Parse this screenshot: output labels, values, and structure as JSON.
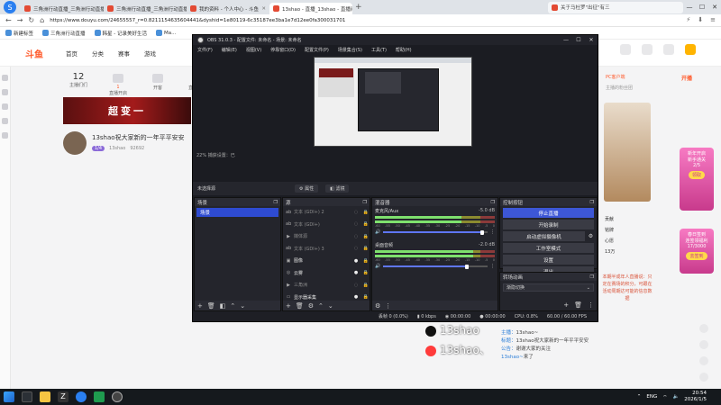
{
  "browser": {
    "tabs": [
      {
        "label": "三角洲行动直播_三角洲行动直播间",
        "active": false
      },
      {
        "label": "三角洲行动直播_三角洲行动直播间",
        "active": false
      },
      {
        "label": "我的资料 - 个人中心 - 斗鱼",
        "active": false
      },
      {
        "label": "13shao - 直播_13shao - 直播间",
        "active": true
      }
    ],
    "right_tab_label": "关于马杜罗\"出征\"有三",
    "url": "https://www.douyu.com/24655557_r=0.8211154635604441&dyshid=1e80119-6c35187ee3ba1e7d12ee0fa300031701",
    "bookmarks": [
      "新建标签",
      "三角洲行动直播",
      "韩星 - 记录美好生活",
      "Ma..."
    ]
  },
  "douyu": {
    "logo": "斗鱼",
    "nav": [
      "首页",
      "分类",
      "赛事",
      "游戏"
    ],
    "quick": [
      {
        "num": "12",
        "label": "主播们们",
        "badge": ""
      },
      {
        "num": "",
        "label": "直播开启",
        "badge": "1"
      },
      {
        "num": "",
        "label": "开客",
        "badge": ""
      },
      {
        "num": "",
        "label": "直播求车",
        "badge": ""
      }
    ],
    "banner_text": "超变一",
    "anchor": {
      "title": "13shao祝大家新的一年平平安安",
      "level": "1/4",
      "name": "13shao",
      "fans": "92692"
    },
    "right": {
      "top": "PC客户端",
      "sub": "主播的粉丝团",
      "items": [
        "贡献",
        "铭牌",
        "",
        "心愿",
        "13万"
      ],
      "vertical": "本期半成年人直播说：只定在赛场的积分，可跟在活动周期达可能的信息数据"
    },
    "promo": {
      "top": "开播",
      "cards": [
        {
          "title": "新年开启",
          "sub": "新手通关",
          "progress": "2/5",
          "btn": "领取"
        },
        {
          "title": "春日签到",
          "sub": "连签领福利",
          "progress": "17/3000",
          "btn": "去签到"
        }
      ]
    },
    "chat": [
      {
        "name": "主播：",
        "text": "13shao~"
      },
      {
        "name": "标题：",
        "text": "13shao祝大家新的一年平平安安"
      },
      {
        "name": "公告：",
        "text": "谢谢大家的关注"
      },
      {
        "name": "13shao~",
        "text": "来了"
      }
    ],
    "overlay": {
      "tiktok": "13shao",
      "weibo": "13shao、"
    }
  },
  "obs": {
    "title": "OBS 31.0.3 - 配置文件: 未命名 - 场景: 未命名",
    "menu": [
      "文件(F)",
      "编辑(E)",
      "视图(V)",
      "停靠窗口(D)",
      "配置文件(P)",
      "场景集合(S)",
      "工具(T)",
      "帮助(H)"
    ],
    "preview_status": "22%   捕获设置：已",
    "toolbar": {
      "no_source": "未选择源",
      "properties": "属性",
      "filters": "滤镜"
    },
    "docks": {
      "scenes": "场景",
      "sources": "源",
      "mixer": "混音器",
      "controls": "控制按钮",
      "transitions": "转场动画"
    },
    "scenes": [
      "场景"
    ],
    "sources": [
      {
        "label": "文本 (GDI+) 2",
        "visible": false
      },
      {
        "label": "文本 (GDI+)",
        "visible": false
      },
      {
        "label": "媒体源",
        "visible": false
      },
      {
        "label": "文本 (GDI+) 3",
        "visible": false
      },
      {
        "label": "图像",
        "visible": true
      },
      {
        "label": "云雾",
        "visible": true
      },
      {
        "label": "三角洲",
        "visible": false
      },
      {
        "label": "显示器采集",
        "visible": true
      }
    ],
    "mixer": [
      {
        "name": "麦克风/Aux",
        "db": "-5.0 dB",
        "level": 0.72,
        "volume": 0.95
      },
      {
        "name": "桌面音频",
        "db": "-2.0 dB",
        "level": 0.82,
        "volume": 0.8
      }
    ],
    "mixer_ticks": [
      "-60",
      "-55",
      "-50",
      "-45",
      "-40",
      "-35",
      "-30",
      "-25",
      "-20",
      "-15",
      "-10",
      "-5",
      "0"
    ],
    "controls": [
      "停止直播",
      "开始录制",
      "启动虚拟摄像机",
      "工作室模式",
      "设置",
      "退出"
    ],
    "transition": "渐隐切换",
    "status": {
      "dropped": "丢帧 0 (0.0%)",
      "kbps": "0 kbps",
      "stream_time": "00:00:00",
      "rec_time": "00:00:00",
      "cpu": "CPU: 0.8%",
      "fps": "60.00 / 60.00 FPS"
    }
  },
  "taskbar": {
    "lang": "ENG",
    "time": "20:54",
    "date": "2026/1/5",
    "apps": [
      "start",
      "search",
      "file-explorer",
      "zip",
      "browser",
      "green-app",
      "obs"
    ]
  }
}
